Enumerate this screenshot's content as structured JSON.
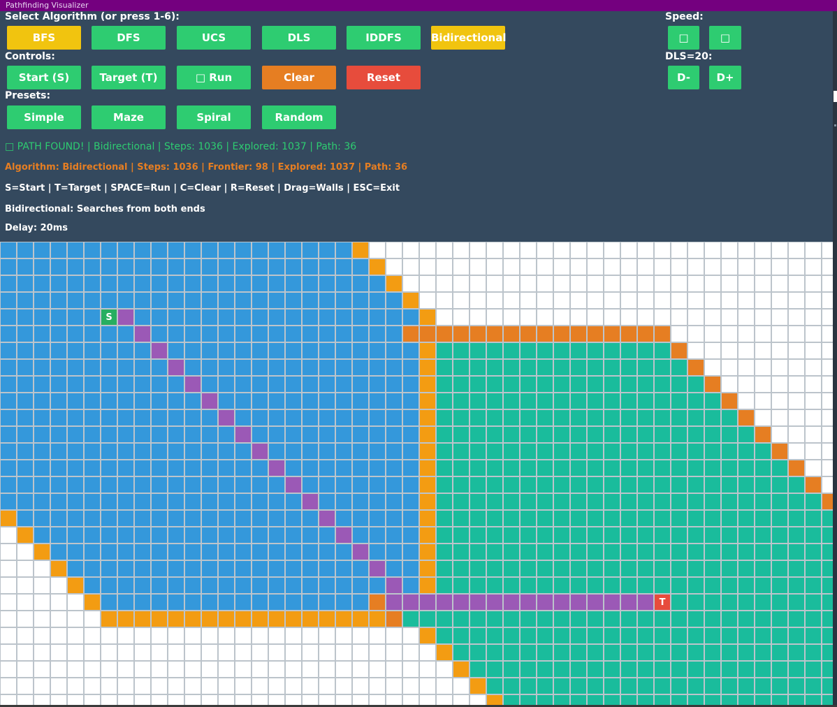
{
  "window": {
    "title": "Pathfinding Visualizer"
  },
  "labels": {
    "select_algorithm": "Select Algorithm (or press 1-6):",
    "controls": "Controls:",
    "presets": "Presets:",
    "speed": "Speed:",
    "dls": "DLS=20:"
  },
  "algorithms": [
    "BFS",
    "DFS",
    "UCS",
    "DLS",
    "IDDFS",
    "Bidirectional"
  ],
  "controls": {
    "start": "Start (S)",
    "target": "Target (T)",
    "run": "□ Run",
    "clear": "Clear",
    "reset": "Reset"
  },
  "speed_buttons": [
    "□",
    "□"
  ],
  "dls_buttons": [
    "D-",
    "D+"
  ],
  "presets": [
    "Simple",
    "Maze",
    "Spiral",
    "Random"
  ],
  "status": {
    "found": "□ PATH FOUND! | Bidirectional | Steps: 1036 | Explored: 1037 | Path: 36",
    "info": "Algorithm: Bidirectional | Steps: 1036 | Frontier: 98 | Explored: 1037 | Path: 36",
    "keys": "S=Start | T=Target | SPACE=Run | C=Clear | R=Reset | Drag=Walls | ESC=Exit",
    "description": "Bidirectional: Searches from both ends",
    "delay": "Delay: 20ms"
  },
  "grid": {
    "cols": 50,
    "rows": 28,
    "start": {
      "row": 4,
      "col": 6,
      "label": "S"
    },
    "target": {
      "row": 21,
      "col": 39,
      "label": "T"
    },
    "colors": {
      "empty": "#ffffff",
      "explored_start": "#3498db",
      "explored_target": "#1abc9c",
      "frontier_start": "#f39c12",
      "frontier_target": "#e67e22",
      "path": "#9b59b6",
      "start": "#27ae60",
      "target": "#e74c3c"
    }
  }
}
